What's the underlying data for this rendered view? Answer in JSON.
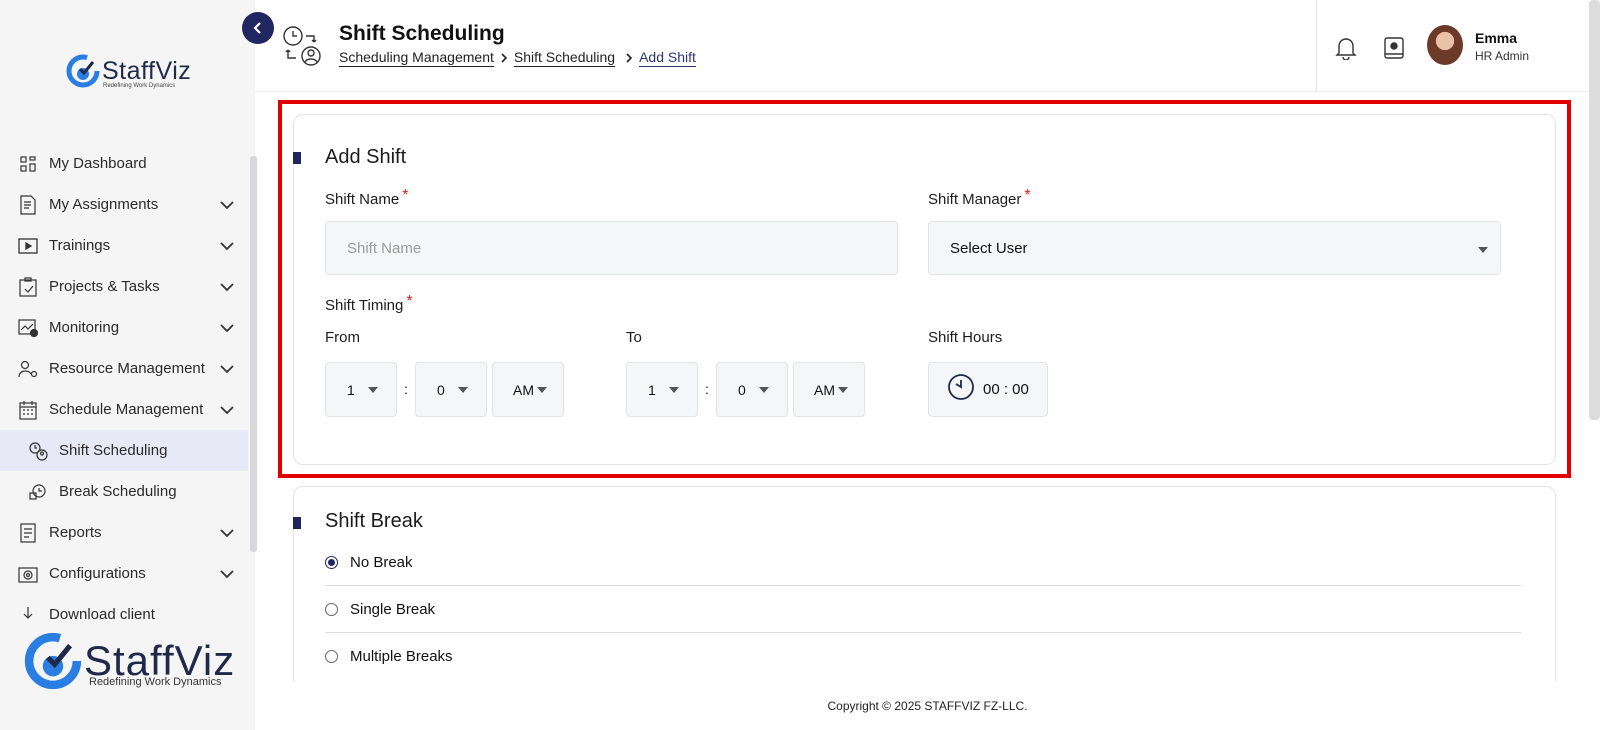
{
  "brand": {
    "name": "StaffViz",
    "tagline_small": "Redefining Work Dynamics",
    "tagline_large": "Redefining Work Dynamics"
  },
  "sidebar": {
    "items": [
      {
        "label": "My Dashboard",
        "icon": "dashboard-icon",
        "expandable": false
      },
      {
        "label": "My Assignments",
        "icon": "assignment-icon",
        "expandable": true
      },
      {
        "label": "Trainings",
        "icon": "training-icon",
        "expandable": true
      },
      {
        "label": "Projects & Tasks",
        "icon": "clipboard-icon",
        "expandable": true
      },
      {
        "label": "Monitoring",
        "icon": "monitoring-icon",
        "expandable": true
      },
      {
        "label": "Resource Management",
        "icon": "resource-icon",
        "expandable": true
      },
      {
        "label": "Schedule Management",
        "icon": "schedule-icon",
        "expandable": true
      },
      {
        "label": "Shift Scheduling",
        "icon": "shift-icon",
        "sub": true,
        "active": true
      },
      {
        "label": "Break Scheduling",
        "icon": "break-icon",
        "sub": true
      },
      {
        "label": "Reports",
        "icon": "reports-icon",
        "expandable": true
      },
      {
        "label": "Configurations",
        "icon": "config-icon",
        "expandable": true
      },
      {
        "label": "Download client",
        "icon": "download-icon",
        "expandable": false
      }
    ]
  },
  "header": {
    "title": "Shift Scheduling",
    "breadcrumb": [
      "Scheduling Management",
      "Shift Scheduling",
      "Add Shift"
    ],
    "user": {
      "name": "Emma",
      "role": "HR Admin"
    }
  },
  "add_shift": {
    "title": "Add Shift",
    "shift_name_label": "Shift Name",
    "shift_name_placeholder": "Shift Name",
    "shift_manager_label": "Shift Manager",
    "shift_manager_value": "Select User",
    "shift_timing_label": "Shift Timing",
    "from_label": "From",
    "to_label": "To",
    "from": {
      "hour": "1",
      "minute": "0",
      "period": "AM"
    },
    "to": {
      "hour": "1",
      "minute": "0",
      "period": "AM"
    },
    "colon": ":",
    "required_mark": "*",
    "shift_hours_label": "Shift Hours",
    "shift_hours_value": "00 : 00"
  },
  "shift_break": {
    "title": "Shift Break",
    "options": [
      {
        "label": "No Break",
        "checked": true
      },
      {
        "label": "Single Break",
        "checked": false
      },
      {
        "label": "Multiple Breaks",
        "checked": false
      }
    ]
  },
  "footer": {
    "copyright": "Copyright © 2025 STAFFVIZ FZ-LLC."
  },
  "colors": {
    "accent": "#1f2660",
    "highlight": "#e00000",
    "required": "#e02020"
  }
}
